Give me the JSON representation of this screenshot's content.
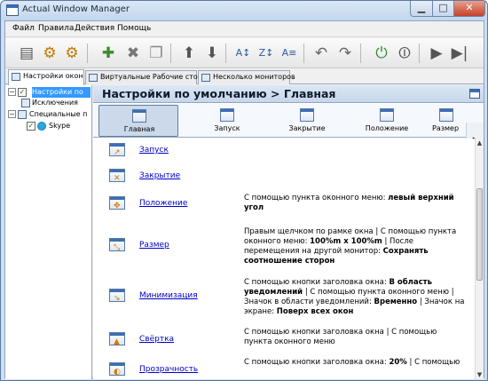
{
  "window": {
    "title": "Actual Window Manager"
  },
  "menu": [
    "Файл",
    "Правила",
    "Действия",
    "Помощь"
  ],
  "tabs": [
    {
      "label": "Настройки окон"
    },
    {
      "label": "Виртуальные Рабочие столы"
    },
    {
      "label": "Несколько мониторов"
    }
  ],
  "tree": [
    {
      "label": "Настройки по"
    },
    {
      "label": "Исключения"
    },
    {
      "label": "Специальные п"
    },
    {
      "label": "Skype"
    }
  ],
  "header": {
    "title": "Настройки по умолчанию > Главная"
  },
  "categories": [
    {
      "label": "Главная"
    },
    {
      "label": "Запуск"
    },
    {
      "label": "Закрытие"
    },
    {
      "label": "Положение"
    },
    {
      "label": "Размер"
    }
  ],
  "rows": [
    {
      "name": "Запуск",
      "desc": ""
    },
    {
      "name": "Закрытие",
      "desc": ""
    },
    {
      "name": "Положение",
      "desc": "С помощью пункта оконного меню: <b>левый верхний угол</b>"
    },
    {
      "name": "Размер",
      "desc": "Правым щелчком по рамке окна | С помощью пункта оконного меню: <b>100%m x 100%m</b> | После перемещения на другой монитор: <b>Сохранять соотношение сторон</b>"
    },
    {
      "name": "Минимизация",
      "desc": "С помощью кнопки заголовка окна: <b>В область уведомлений</b> | С помощью пункта оконного меню | Значок в области уведомлений: <b>Временно</b> | Значок на экране: <b>Поверх всех окон</b>"
    },
    {
      "name": "Свёртка",
      "desc": "С помощью кнопки заголовка окна | С помощью пункта оконного меню"
    },
    {
      "name": "Прозрачность",
      "desc": "С помощью кнопки заголовка окна: <b>20%</b> | С помощью"
    }
  ],
  "icons": {
    "toolbar": [
      "save-icon",
      "new-rule-icon",
      "new-rule-2-icon",
      "add-icon",
      "delete-icon",
      "copy-icon",
      "move-up-icon",
      "move-down-icon",
      "sort-az-icon",
      "sort-za-icon",
      "undo-icon",
      "redo-icon",
      "power-icon",
      "stop-icon",
      "play-icon",
      "step-icon"
    ]
  }
}
